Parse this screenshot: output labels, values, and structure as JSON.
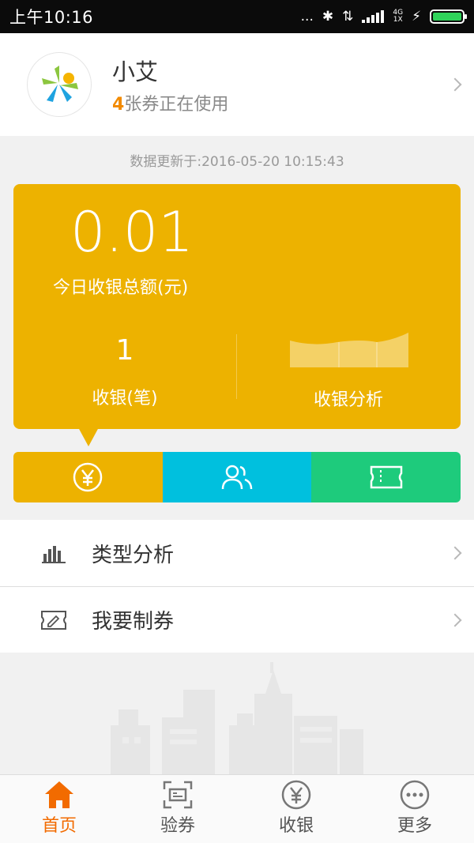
{
  "status_bar": {
    "time": "上午10:16",
    "dots": "...",
    "network_top": "4G",
    "network_bottom": "1X"
  },
  "profile": {
    "name": "小艾",
    "coupon_count": "4",
    "coupon_text": "张券正在使用"
  },
  "updated": "数据更新于:2016-05-20 10:15:43",
  "summary": {
    "total_amount": "0.01",
    "total_label": "今日收银总额(元)",
    "count": "1",
    "count_label": "收银(笔)",
    "analysis_label": "收银分析"
  },
  "tabs": [
    {
      "name": "cashier",
      "icon": "yen-circle-icon",
      "color": "#edb200"
    },
    {
      "name": "members",
      "icon": "users-icon",
      "color": "#00c0de"
    },
    {
      "name": "coupons",
      "icon": "ticket-icon",
      "color": "#1ecb7c"
    }
  ],
  "menu": [
    {
      "label": "类型分析",
      "icon": "bar-chart-icon"
    },
    {
      "label": "我要制券",
      "icon": "coupon-edit-icon"
    }
  ],
  "bottom_nav": [
    {
      "label": "首页",
      "icon": "home-icon",
      "active": true
    },
    {
      "label": "验券",
      "icon": "scan-coupon-icon",
      "active": false
    },
    {
      "label": "收银",
      "icon": "yen-icon",
      "active": false
    },
    {
      "label": "更多",
      "icon": "more-icon",
      "active": false
    }
  ],
  "colors": {
    "accent": "#edb200",
    "teal": "#00c0de",
    "green": "#1ecb7c",
    "orange": "#f26b00"
  }
}
